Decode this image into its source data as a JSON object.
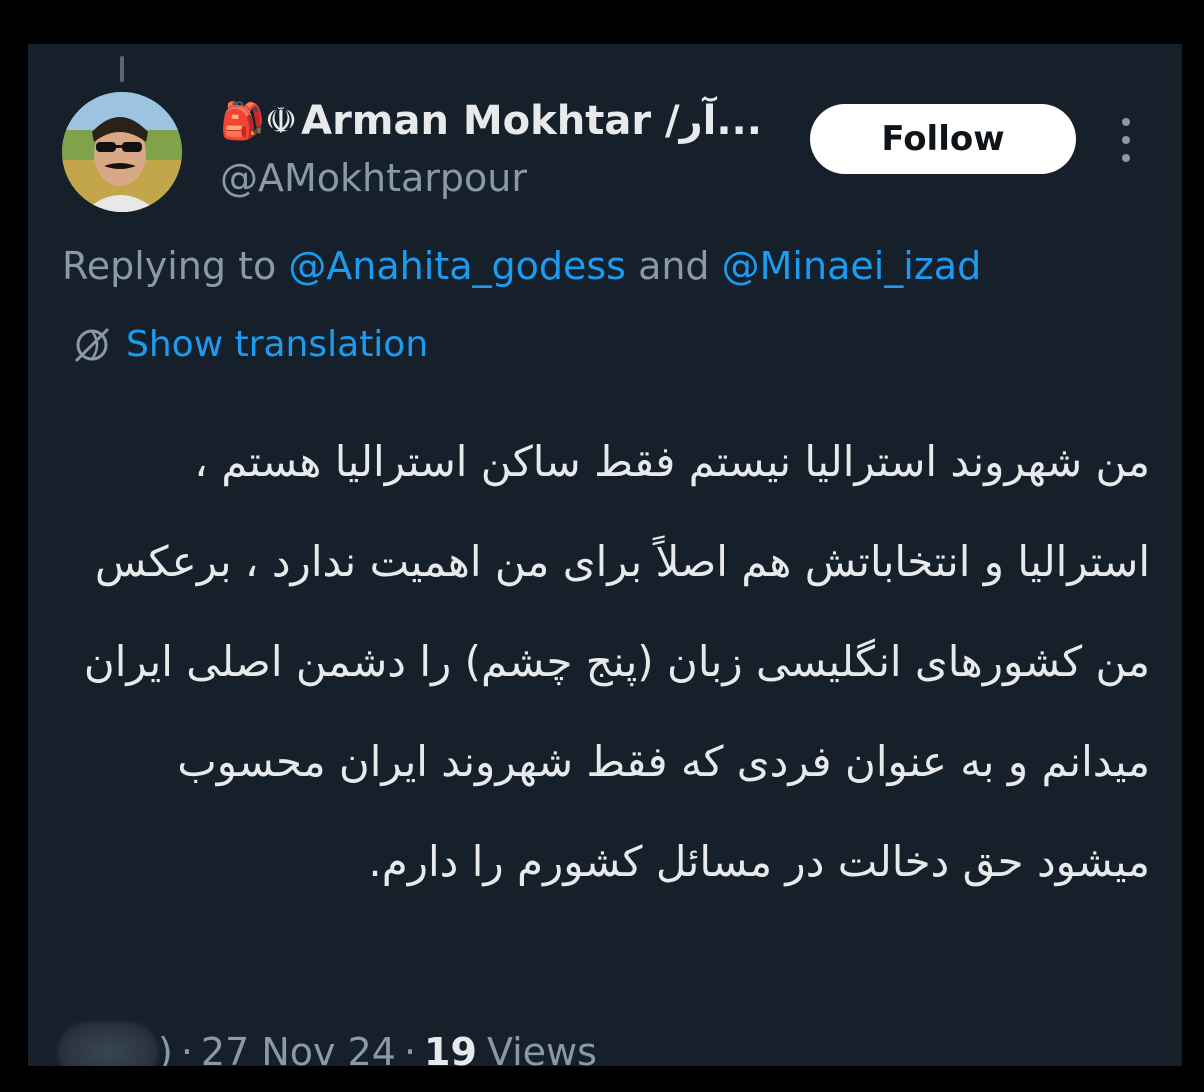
{
  "author": {
    "emoji_prefix": "🎒☫",
    "display_name": "Arman Mokhtar /آر...",
    "handle": "@AMokhtarpour"
  },
  "actions": {
    "follow_label": "Follow",
    "more_icon": "more-vertical-icon"
  },
  "replying": {
    "prefix": "Replying to ",
    "mention_1": "@Anahita_godess",
    "joiner": " and ",
    "mention_2": "@Minaei_izad"
  },
  "translation": {
    "icon": "translate-globe-icon",
    "label": "Show translation"
  },
  "tweet": {
    "text": "من شهروند استرالیا نیستم فقط ساکن استرالیا هستم ، استرالیا و انتخاباتش هم اصلاً برای من اهمیت ندارد ، برعکس من کشورهای انگلیسی زبان (پنج چشم) را دشمن اصلی ایران میدانم و به عنوان فردی که فقط شهروند ایران محسوب میشود حق دخالت در مسائل کشورم را دارم."
  },
  "meta": {
    "time_fragment": ")",
    "date": "27 Nov 24",
    "separator": "·",
    "views_count": "19",
    "views_label": "Views"
  },
  "colors": {
    "background": "#15202b",
    "text": "#e7e9ea",
    "muted": "#8b98a5",
    "accent": "#1d9bf0",
    "button_bg": "#ffffff"
  }
}
